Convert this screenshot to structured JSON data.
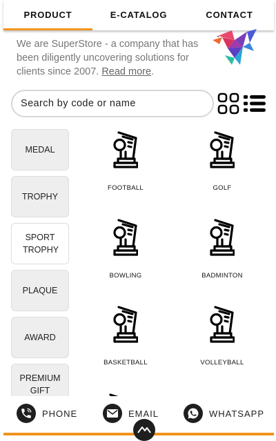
{
  "nav": {
    "tabs": [
      {
        "label": "PRODUCT",
        "active": true
      },
      {
        "label": "E-CATALOG",
        "active": false
      },
      {
        "label": "CONTACT",
        "active": false
      }
    ],
    "accent_color": "#f2941f"
  },
  "intro": {
    "text": "We are SuperStore - a company that has been diligently uncovering solutions for clients since 2007. ",
    "link": "Read more",
    "suffix": "."
  },
  "search": {
    "placeholder": "Search by code or name",
    "value": ""
  },
  "view_toggle": {
    "grid_icon": "grid-view-icon",
    "list_icon": "list-view-icon"
  },
  "categories": [
    {
      "label": "MEDAL"
    },
    {
      "label": "TROPHY"
    },
    {
      "label": "SPORT TROPHY",
      "active": true
    },
    {
      "label": "PLAQUE"
    },
    {
      "label": "AWARD"
    },
    {
      "label": "PREMIUM GIFT"
    }
  ],
  "products": [
    {
      "name": "FOOTBALL",
      "icon": "trophy-icon"
    },
    {
      "name": "GOLF",
      "icon": "trophy-icon"
    },
    {
      "name": "BOWLING",
      "icon": "trophy-icon"
    },
    {
      "name": "BADMINTON",
      "icon": "trophy-icon"
    },
    {
      "name": "BASKETBALL",
      "icon": "trophy-icon"
    },
    {
      "name": "VOLLEYBALL",
      "icon": "trophy-icon"
    }
  ],
  "bottom_bar": {
    "items": [
      {
        "label": "PHONE",
        "icon": "phone-icon"
      },
      {
        "label": "EMAIL",
        "icon": "email-icon"
      },
      {
        "label": "WHATSAPP",
        "icon": "whatsapp-icon"
      }
    ],
    "fab_icon": "logo-icon"
  }
}
